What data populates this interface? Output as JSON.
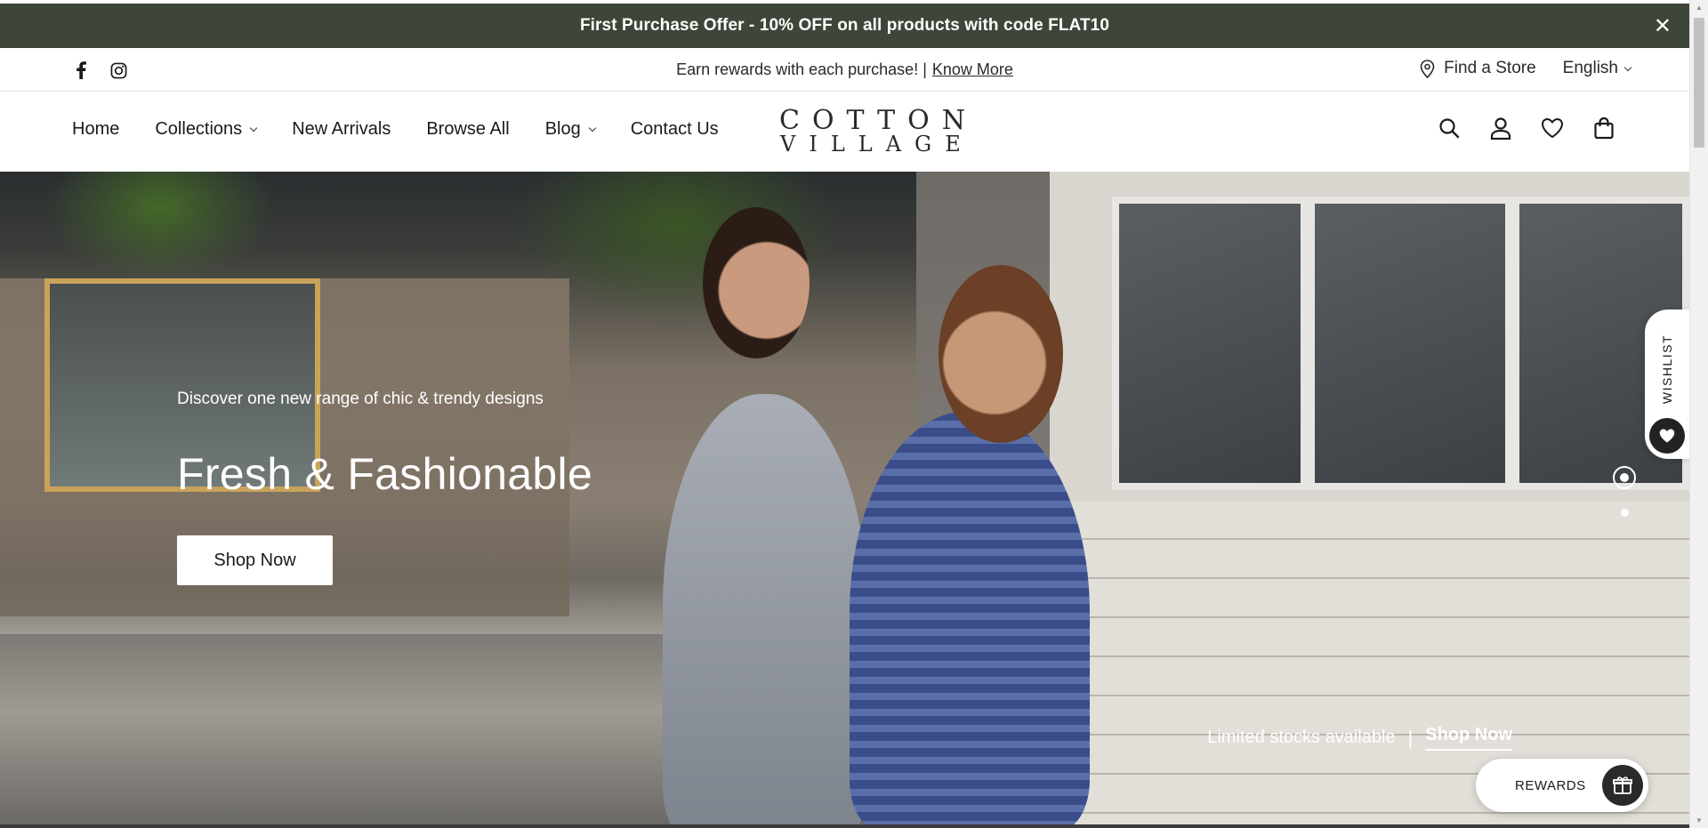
{
  "announcement": {
    "text": "First Purchase Offer - 10% OFF on all products with code FLAT10",
    "close_icon": "close-icon"
  },
  "utility": {
    "social": [
      {
        "icon": "facebook-icon"
      },
      {
        "icon": "instagram-icon"
      }
    ],
    "promo_text": "Earn rewards with each purchase! |",
    "promo_link": "Know More",
    "find_store": "Find a Store",
    "language": "English"
  },
  "nav": {
    "items": [
      {
        "label": "Home",
        "dropdown": false
      },
      {
        "label": "Collections",
        "dropdown": true
      },
      {
        "label": "New Arrivals",
        "dropdown": false
      },
      {
        "label": "Browse All",
        "dropdown": false
      },
      {
        "label": "Blog",
        "dropdown": true
      },
      {
        "label": "Contact Us",
        "dropdown": false
      }
    ]
  },
  "logo": {
    "line1": "COTTON",
    "line2": "VILLAGE"
  },
  "actions": {
    "icons": [
      "search-icon",
      "account-icon",
      "wishlist-heart-icon",
      "cart-bag-icon"
    ]
  },
  "hero": {
    "kicker": "Discover one new range of chic & trendy designs",
    "title": "Fresh & Fashionable",
    "button": "Shop Now",
    "limited_text": "Limited stocks available",
    "limited_sep": "|",
    "limited_link": "Shop Now",
    "slides": {
      "count": 2,
      "active": 1
    }
  },
  "wishlist_tab": {
    "label": "WISHLIST"
  },
  "rewards": {
    "label": "REWARDS"
  },
  "colors": {
    "announcement_bg": "#3e4639",
    "text": "#1a1a1a",
    "white": "#ffffff"
  }
}
